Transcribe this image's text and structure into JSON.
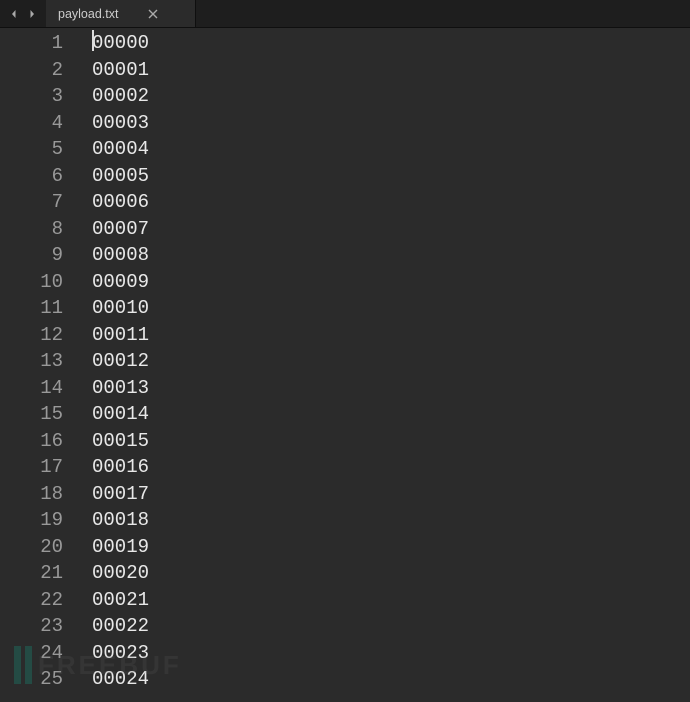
{
  "tab": {
    "title": "payload.txt"
  },
  "editor": {
    "active_line": 1,
    "lines": [
      {
        "num": "1",
        "text": "00000"
      },
      {
        "num": "2",
        "text": "00001"
      },
      {
        "num": "3",
        "text": "00002"
      },
      {
        "num": "4",
        "text": "00003"
      },
      {
        "num": "5",
        "text": "00004"
      },
      {
        "num": "6",
        "text": "00005"
      },
      {
        "num": "7",
        "text": "00006"
      },
      {
        "num": "8",
        "text": "00007"
      },
      {
        "num": "9",
        "text": "00008"
      },
      {
        "num": "10",
        "text": "00009"
      },
      {
        "num": "11",
        "text": "00010"
      },
      {
        "num": "12",
        "text": "00011"
      },
      {
        "num": "13",
        "text": "00012"
      },
      {
        "num": "14",
        "text": "00013"
      },
      {
        "num": "15",
        "text": "00014"
      },
      {
        "num": "16",
        "text": "00015"
      },
      {
        "num": "17",
        "text": "00016"
      },
      {
        "num": "18",
        "text": "00017"
      },
      {
        "num": "19",
        "text": "00018"
      },
      {
        "num": "20",
        "text": "00019"
      },
      {
        "num": "21",
        "text": "00020"
      },
      {
        "num": "22",
        "text": "00021"
      },
      {
        "num": "23",
        "text": "00022"
      },
      {
        "num": "24",
        "text": "00023"
      },
      {
        "num": "25",
        "text": "00024"
      }
    ]
  },
  "watermark": {
    "text": "FREEBUF"
  }
}
